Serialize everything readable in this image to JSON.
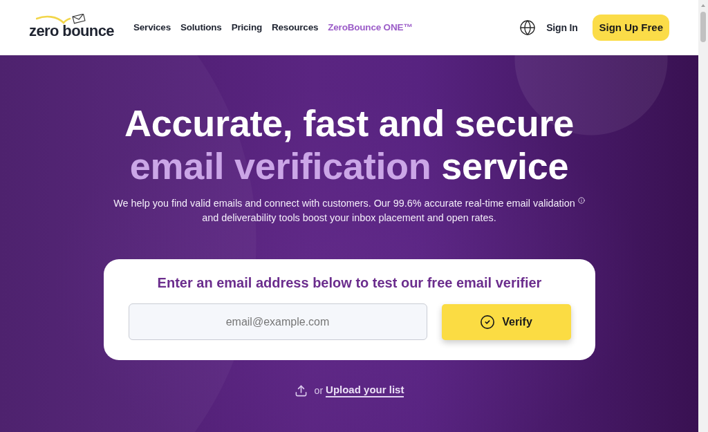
{
  "header": {
    "logo": {
      "text": "zero bounce"
    },
    "nav": [
      {
        "label": "Services",
        "accent": false
      },
      {
        "label": "Solutions",
        "accent": false
      },
      {
        "label": "Pricing",
        "accent": false
      },
      {
        "label": "Resources",
        "accent": false
      },
      {
        "label": "ZeroBounce ONE™",
        "accent": true
      }
    ],
    "sign_in": "Sign In",
    "cta": "Sign Up Free"
  },
  "hero": {
    "headline": [
      [
        {
          "text": "Accurate, fast and secure",
          "accent": false
        }
      ],
      [
        {
          "text": "email verification",
          "accent": true
        },
        {
          "text": "service",
          "accent": false
        }
      ]
    ],
    "description": [
      "We help you find valid emails and connect with customers. Our 99.6% accurate real-time email validation",
      "and deliverability tools boost your inbox placement and open rates."
    ],
    "verifier": {
      "heading": "Enter an email address below to test our free email verifier",
      "email_input": {
        "placeholder": "email@example.com"
      },
      "button": "Verify"
    },
    "upload": {
      "prefix": "or",
      "link": "Upload your list"
    }
  }
}
